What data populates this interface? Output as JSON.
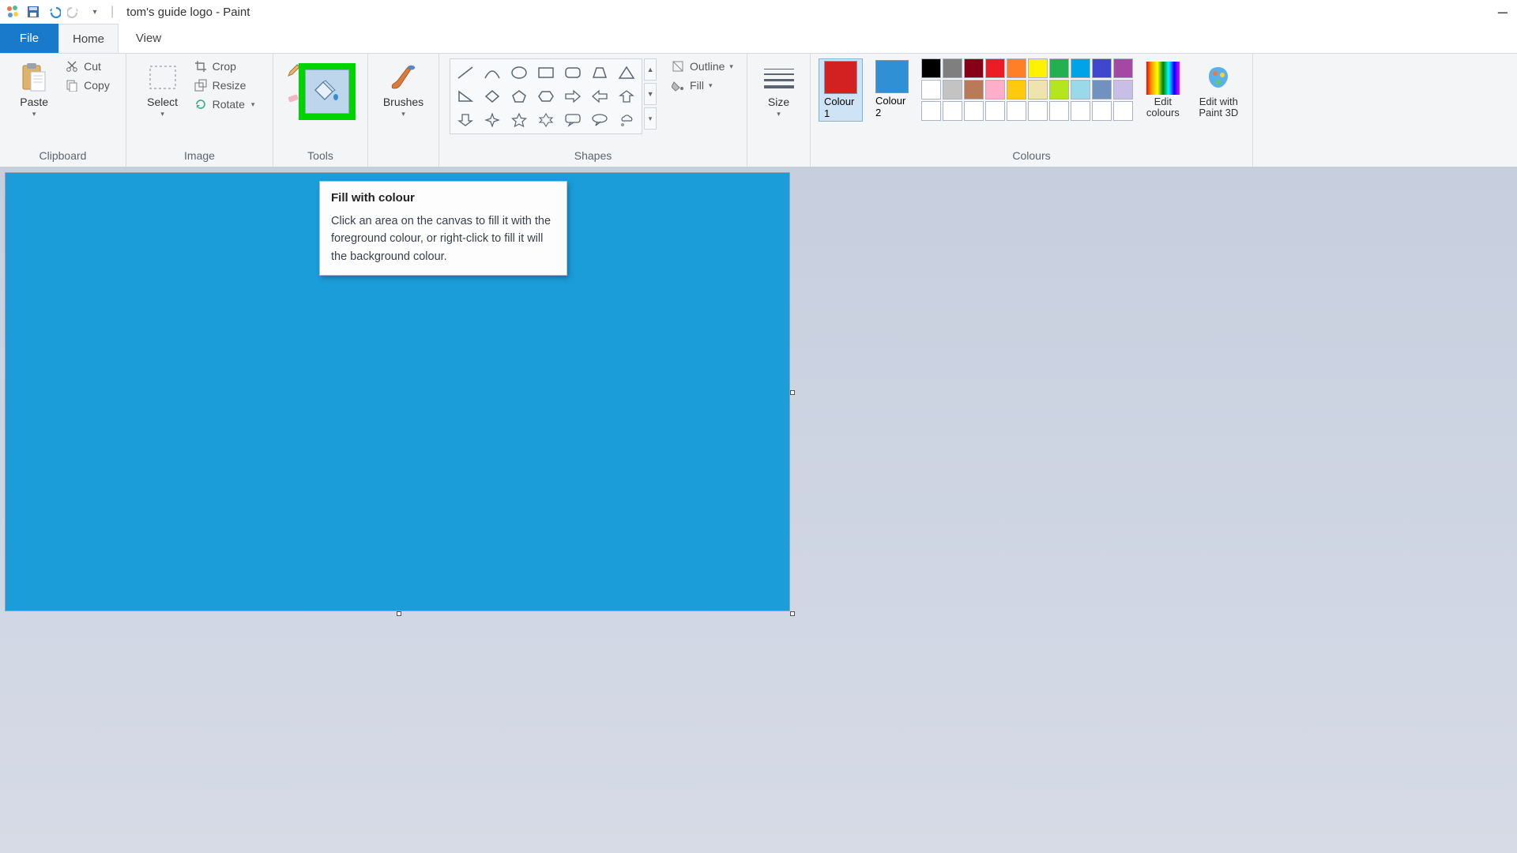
{
  "title": "tom's guide logo - Paint",
  "menubar": {
    "file": "File",
    "home": "Home",
    "view": "View"
  },
  "groups": {
    "clipboard": {
      "label": "Clipboard",
      "paste": "Paste",
      "cut": "Cut",
      "copy": "Copy"
    },
    "image": {
      "label": "Image",
      "select": "Select",
      "crop": "Crop",
      "resize": "Resize",
      "rotate": "Rotate"
    },
    "tools": {
      "label": "Tools"
    },
    "brushes": {
      "label": "Brushes",
      "btn": "Brushes"
    },
    "shapes": {
      "label": "Shapes",
      "outline": "Outline",
      "fill": "Fill"
    },
    "size": {
      "label": "Size",
      "btn": "Size"
    },
    "colours": {
      "label": "Colours",
      "c1": "Colour 1",
      "c2": "Colour 2",
      "edit": "Edit colours",
      "paint3d": "Edit with Paint 3D",
      "c1_hex": "#d32020",
      "c2_hex": "#2f90d6",
      "row1": [
        "#000000",
        "#7f7f7f",
        "#880015",
        "#ed1c24",
        "#ff7f27",
        "#fff200",
        "#22b14c",
        "#00a2e8",
        "#3f48cc",
        "#a349a4"
      ],
      "row2": [
        "#ffffff",
        "#c3c3c3",
        "#b97a57",
        "#ffaec9",
        "#ffc90e",
        "#efe4b0",
        "#b5e61d",
        "#99d9ea",
        "#7092be",
        "#c8bfe7"
      ]
    }
  },
  "tooltip": {
    "title": "Fill with colour",
    "body": "Click an area on the canvas to fill it with the foreground colour, or right-click to fill it will the background colour."
  },
  "canvas": {
    "fill": "#1b9dd9"
  }
}
